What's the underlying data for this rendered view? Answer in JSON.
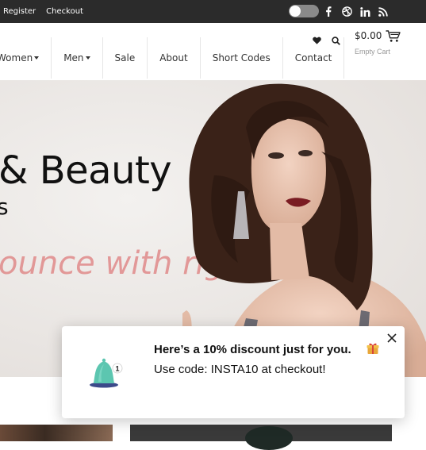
{
  "topbar": {
    "links": [
      "Register",
      "Checkout"
    ],
    "social_icons": [
      "facebook-icon",
      "dribbble-icon",
      "linkedin-icon",
      "rss-icon"
    ]
  },
  "nav": {
    "items": [
      {
        "label": "Women",
        "dropdown": true
      },
      {
        "label": "Men",
        "dropdown": true
      },
      {
        "label": "Sale",
        "dropdown": false
      },
      {
        "label": "About",
        "dropdown": false
      },
      {
        "label": "Short Codes",
        "dropdown": false
      },
      {
        "label": "Contact",
        "dropdown": false
      }
    ]
  },
  "header": {
    "wishlist_icon": "heart-icon",
    "search_icon": "search-icon",
    "cart_amount": "$0.00",
    "cart_status": "Empty Cart",
    "cart_icon": "cart-icon"
  },
  "hero": {
    "title": "& Beauty",
    "subtitle": "s",
    "tagline": "ounce with righ"
  },
  "popup": {
    "headline": "Here’s a 10% discount just for you.",
    "code_text": "Use code: INSTA10 at checkout!",
    "bell_badge": "1",
    "accent_color": "#5cc6b0"
  }
}
